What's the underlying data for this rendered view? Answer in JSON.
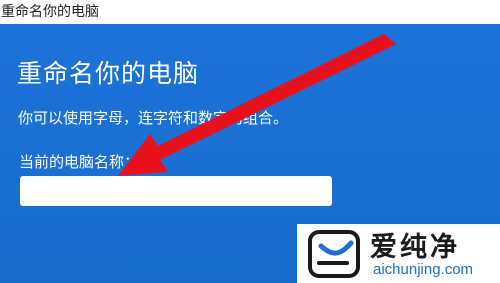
{
  "window": {
    "title": "重命名你的电脑"
  },
  "dialog": {
    "title": "重命名你的电脑",
    "description": "你可以使用字母，连字符和数字的组合。",
    "field_label": "当前的电脑名称：",
    "input_value": "",
    "input_placeholder": ""
  },
  "watermark": {
    "name": "爱纯净",
    "url": "aichunjing.com"
  },
  "colors": {
    "dialog_background": "#1a6fd2",
    "arrow": "#e8101a",
    "watermark_url": "#1c6fd6"
  }
}
